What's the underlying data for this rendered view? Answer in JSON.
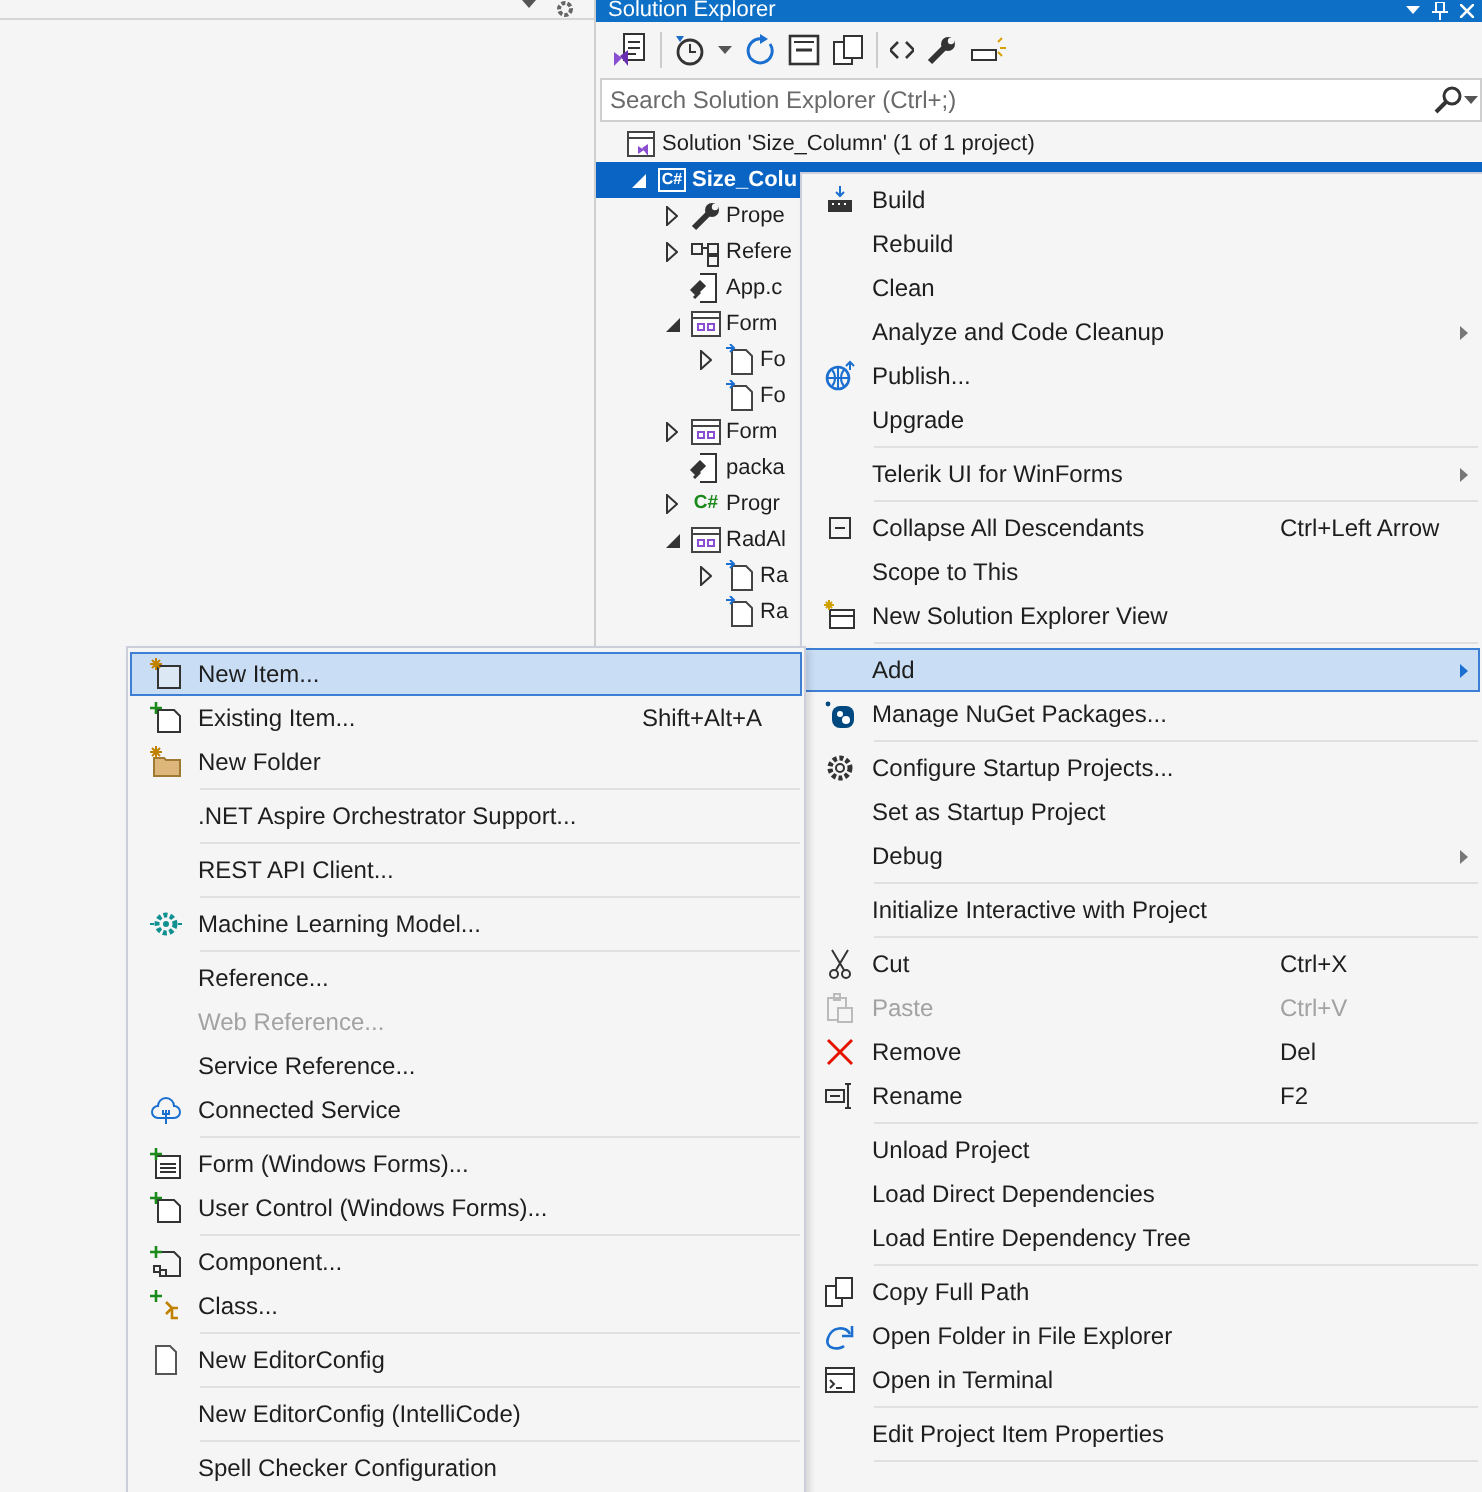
{
  "solution_explorer": {
    "title": "Solution Explorer",
    "search": {
      "placeholder": "Search Solution Explorer (Ctrl+;)"
    },
    "tree": [
      {
        "kind": "solution",
        "label": "Solution 'Size_Column' (1 of 1 project)",
        "selected": false,
        "children": [
          {
            "kind": "project",
            "icon_text": "C#",
            "label": "Size_Colu",
            "selected": true,
            "expanded": true,
            "children": [
              {
                "kind": "properties",
                "label": "Prope",
                "selected": false,
                "expanded": false
              },
              {
                "kind": "references",
                "label": "Refere",
                "selected": false,
                "expanded": false
              },
              {
                "kind": "config",
                "label": "App.c",
                "selected": false
              },
              {
                "kind": "form",
                "label": "Form",
                "selected": false,
                "expanded": true,
                "children": [
                  {
                    "kind": "file",
                    "label": "Fo",
                    "selected": false,
                    "expanded": false
                  },
                  {
                    "kind": "file",
                    "label": "Fo",
                    "selected": false
                  }
                ]
              },
              {
                "kind": "form",
                "label": "Form",
                "selected": false,
                "expanded": false
              },
              {
                "kind": "config",
                "label": "packa",
                "selected": false
              },
              {
                "kind": "csharp",
                "icon_text": "C#",
                "label": "Progr",
                "selected": false,
                "expanded": false
              },
              {
                "kind": "form",
                "label": "RadAl",
                "selected": false,
                "expanded": true,
                "children": [
                  {
                    "kind": "file",
                    "label": "Ra",
                    "selected": false,
                    "expanded": false
                  },
                  {
                    "kind": "file",
                    "label": "Ra",
                    "selected": false
                  }
                ]
              }
            ]
          }
        ]
      }
    ]
  },
  "context_menu": {
    "items": [
      {
        "kind": "item",
        "label": "Build",
        "selected": false,
        "disabled": false,
        "submenu": false
      },
      {
        "kind": "item",
        "label": "Rebuild",
        "selected": false,
        "disabled": false,
        "submenu": false
      },
      {
        "kind": "item",
        "label": "Clean",
        "selected": false,
        "disabled": false,
        "submenu": false
      },
      {
        "kind": "item",
        "label": "Analyze and Code Cleanup",
        "selected": false,
        "disabled": false,
        "submenu": true
      },
      {
        "kind": "item",
        "label": "Publish...",
        "selected": false,
        "disabled": false,
        "submenu": false
      },
      {
        "kind": "item",
        "label": "Upgrade",
        "selected": false,
        "disabled": false,
        "submenu": false
      },
      {
        "kind": "separator"
      },
      {
        "kind": "item",
        "label": "Telerik UI for WinForms",
        "selected": false,
        "disabled": false,
        "submenu": true
      },
      {
        "kind": "separator"
      },
      {
        "kind": "item",
        "label": "Collapse All Descendants",
        "shortcut": "Ctrl+Left Arrow",
        "selected": false,
        "disabled": false,
        "submenu": false
      },
      {
        "kind": "item",
        "label": "Scope to This",
        "selected": false,
        "disabled": false,
        "submenu": false
      },
      {
        "kind": "item",
        "label": "New Solution Explorer View",
        "selected": false,
        "disabled": false,
        "submenu": false
      },
      {
        "kind": "separator"
      },
      {
        "kind": "item",
        "label": "Add",
        "selected": true,
        "disabled": false,
        "submenu": true
      },
      {
        "kind": "item",
        "label": "Manage NuGet Packages...",
        "selected": false,
        "disabled": false,
        "submenu": false
      },
      {
        "kind": "separator"
      },
      {
        "kind": "item",
        "label": "Configure Startup Projects...",
        "selected": false,
        "disabled": false,
        "submenu": false
      },
      {
        "kind": "item",
        "label": "Set as Startup Project",
        "selected": false,
        "disabled": false,
        "submenu": false
      },
      {
        "kind": "item",
        "label": "Debug",
        "selected": false,
        "disabled": false,
        "submenu": true
      },
      {
        "kind": "separator"
      },
      {
        "kind": "item",
        "label": "Initialize Interactive with Project",
        "selected": false,
        "disabled": false,
        "submenu": false
      },
      {
        "kind": "separator"
      },
      {
        "kind": "item",
        "label": "Cut",
        "shortcut": "Ctrl+X",
        "selected": false,
        "disabled": false,
        "submenu": false
      },
      {
        "kind": "item",
        "label": "Paste",
        "shortcut": "Ctrl+V",
        "selected": false,
        "disabled": true,
        "submenu": false
      },
      {
        "kind": "item",
        "label": "Remove",
        "shortcut": "Del",
        "selected": false,
        "disabled": false,
        "submenu": false
      },
      {
        "kind": "item",
        "label": "Rename",
        "shortcut": "F2",
        "selected": false,
        "disabled": false,
        "submenu": false
      },
      {
        "kind": "separator"
      },
      {
        "kind": "item",
        "label": "Unload Project",
        "selected": false,
        "disabled": false,
        "submenu": false
      },
      {
        "kind": "item",
        "label": "Load Direct Dependencies",
        "selected": false,
        "disabled": false,
        "submenu": false
      },
      {
        "kind": "item",
        "label": "Load Entire Dependency Tree",
        "selected": false,
        "disabled": false,
        "submenu": false
      },
      {
        "kind": "separator"
      },
      {
        "kind": "item",
        "label": "Copy Full Path",
        "selected": false,
        "disabled": false,
        "submenu": false
      },
      {
        "kind": "item",
        "label": "Open Folder in File Explorer",
        "selected": false,
        "disabled": false,
        "submenu": false
      },
      {
        "kind": "item",
        "label": "Open in Terminal",
        "selected": false,
        "disabled": false,
        "submenu": false
      },
      {
        "kind": "separator"
      },
      {
        "kind": "item",
        "label": "Edit Project Item Properties",
        "selected": false,
        "disabled": false,
        "submenu": false
      },
      {
        "kind": "separator"
      }
    ]
  },
  "add_submenu": {
    "items": [
      {
        "kind": "item",
        "label": "New Item...",
        "selected": true,
        "disabled": false,
        "submenu": false
      },
      {
        "kind": "item",
        "label": "Existing Item...",
        "shortcut": "Shift+Alt+A",
        "selected": false,
        "disabled": false,
        "submenu": false
      },
      {
        "kind": "item",
        "label": "New Folder",
        "selected": false,
        "disabled": false,
        "submenu": false
      },
      {
        "kind": "separator"
      },
      {
        "kind": "item",
        "label": ".NET Aspire Orchestrator Support...",
        "selected": false,
        "disabled": false,
        "submenu": false
      },
      {
        "kind": "separator"
      },
      {
        "kind": "item",
        "label": "REST API Client...",
        "selected": false,
        "disabled": false,
        "submenu": false
      },
      {
        "kind": "separator"
      },
      {
        "kind": "item",
        "label": "Machine Learning Model...",
        "selected": false,
        "disabled": false,
        "submenu": false
      },
      {
        "kind": "separator"
      },
      {
        "kind": "item",
        "label": "Reference...",
        "selected": false,
        "disabled": false,
        "submenu": false
      },
      {
        "kind": "item",
        "label": "Web Reference...",
        "selected": false,
        "disabled": true,
        "submenu": false
      },
      {
        "kind": "item",
        "label": "Service Reference...",
        "selected": false,
        "disabled": false,
        "submenu": false
      },
      {
        "kind": "item",
        "label": "Connected Service",
        "selected": false,
        "disabled": false,
        "submenu": false
      },
      {
        "kind": "separator"
      },
      {
        "kind": "item",
        "label": "Form (Windows Forms)...",
        "selected": false,
        "disabled": false,
        "submenu": false
      },
      {
        "kind": "item",
        "label": "User Control (Windows Forms)...",
        "selected": false,
        "disabled": false,
        "submenu": false
      },
      {
        "kind": "separator"
      },
      {
        "kind": "item",
        "label": "Component...",
        "selected": false,
        "disabled": false,
        "submenu": false
      },
      {
        "kind": "item",
        "label": "Class...",
        "selected": false,
        "disabled": false,
        "submenu": false
      },
      {
        "kind": "separator"
      },
      {
        "kind": "item",
        "label": "New EditorConfig",
        "selected": false,
        "disabled": false,
        "submenu": false
      },
      {
        "kind": "separator"
      },
      {
        "kind": "item",
        "label": "New EditorConfig (IntelliCode)",
        "selected": false,
        "disabled": false,
        "submenu": false
      },
      {
        "kind": "separator"
      },
      {
        "kind": "item",
        "label": "Spell Checker Configuration",
        "selected": false,
        "disabled": false,
        "submenu": false
      }
    ]
  }
}
